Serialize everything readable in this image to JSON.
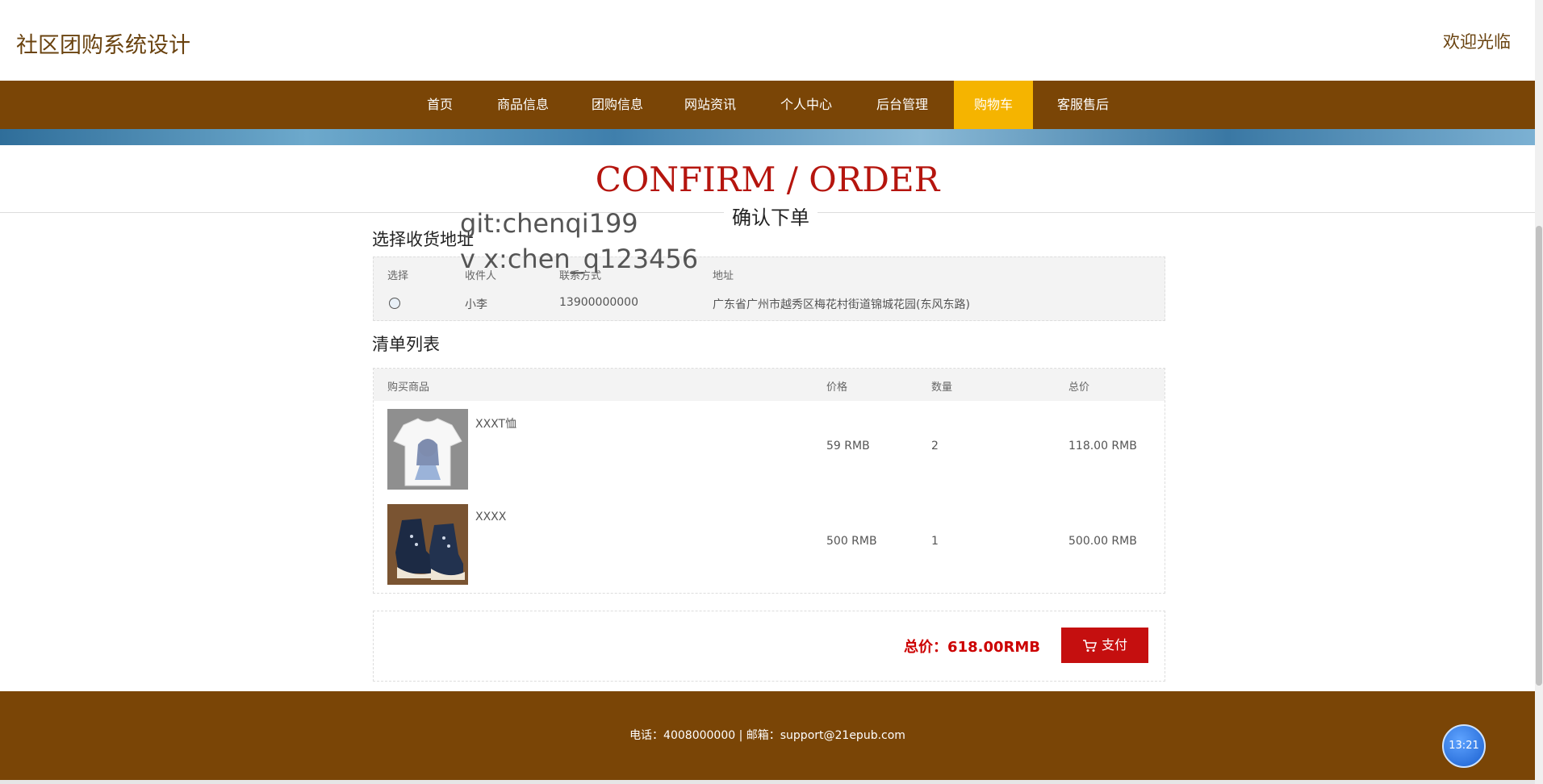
{
  "header": {
    "site_title": "社区团购系统设计",
    "welcome": "欢迎光临"
  },
  "nav": {
    "items": [
      {
        "label": "首页"
      },
      {
        "label": "商品信息"
      },
      {
        "label": "团购信息"
      },
      {
        "label": "网站资讯"
      },
      {
        "label": "个人中心"
      },
      {
        "label": "后台管理"
      },
      {
        "label": "购物车",
        "active": true
      },
      {
        "label": "客服售后"
      }
    ]
  },
  "hero": {
    "title": "CONFIRM / ORDER",
    "subtitle": "确认下单"
  },
  "watermark": {
    "line1": "git:chenqi199",
    "line2": "v x:chen_q123456"
  },
  "address": {
    "section_title": "选择收货地址",
    "headers": {
      "select": "选择",
      "receiver": "收件人",
      "phone": "联系方式",
      "address": "地址"
    },
    "row": {
      "receiver": "小李",
      "phone": "13900000000",
      "address": "广东省广州市越秀区梅花村街道锦城花园(东风东路)"
    }
  },
  "order_list": {
    "section_title": "清单列表",
    "headers": {
      "product": "购买商品",
      "price": "价格",
      "qty": "数量",
      "total": "总价"
    },
    "items": [
      {
        "name": "XXXT恤",
        "price": "59 RMB",
        "qty": "2",
        "total": "118.00 RMB"
      },
      {
        "name": "XXXX",
        "price": "500 RMB",
        "qty": "1",
        "total": "500.00 RMB"
      }
    ]
  },
  "summary": {
    "total": "总价：618.00RMB",
    "pay_label": "支付"
  },
  "footer": {
    "contact": "电话：4008000000 | 邮箱：support@21epub.com"
  },
  "clock": {
    "time": "13:21"
  },
  "colors": {
    "brand": "#7a4506",
    "active_nav": "#f5b400",
    "accent": "#c50f0f"
  }
}
